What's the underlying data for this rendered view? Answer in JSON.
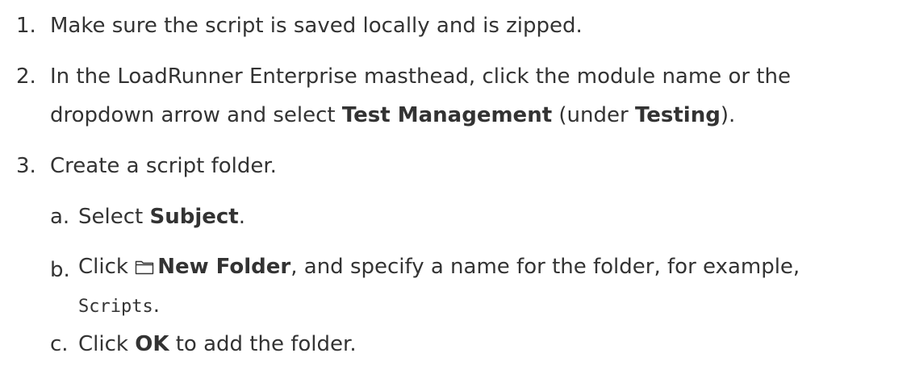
{
  "steps": [
    {
      "num": "1.",
      "text": "Make sure the script is saved locally and is zipped."
    },
    {
      "num": "2.",
      "line1": "In the LoadRunner Enterprise masthead, click the module name or the",
      "line2_pre": "dropdown arrow and select ",
      "line2_bold1": "Test Management",
      "line2_mid": " (under ",
      "line2_bold2": "Testing",
      "line2_post": ")."
    },
    {
      "num": "3.",
      "text": "Create a script folder.",
      "substeps": [
        {
          "letter": "a.",
          "pre": "Select ",
          "bold": "Subject",
          "post": "."
        },
        {
          "letter": "b.",
          "pre": "Click ",
          "icon": "folder-icon",
          "bold": "New Folder",
          "post": ", and specify a name for the folder, for example,",
          "code": "Scripts",
          "code_post": "."
        },
        {
          "letter": "c.",
          "pre": "Click ",
          "bold": "OK",
          "post": " to add the folder."
        }
      ]
    }
  ]
}
